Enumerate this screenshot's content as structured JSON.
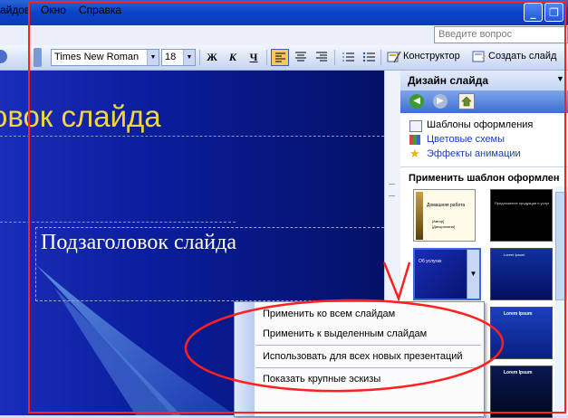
{
  "menubar": {
    "items": [
      "айдов",
      "Окно",
      "Справка"
    ],
    "ask_placeholder": "Введите вопрос"
  },
  "toolbar": {
    "font_name": "Times New Roman",
    "font_size": "18",
    "bold": "Ж",
    "italic": "К",
    "underline": "Ч",
    "designer": "Конструктор",
    "new_slide": "Создать слайд"
  },
  "slide": {
    "title": "овок слайда",
    "subtitle": "Подзаголовок слайда"
  },
  "taskpane": {
    "title": "Дизайн слайда",
    "links": [
      "Шаблоны оформления",
      "Цветовые схемы",
      "Эффекты анимации"
    ],
    "section_title": "Применить шаблон оформлен",
    "thumbs": [
      {
        "title": "Домашняя работа",
        "lines": [
          "[Автор]",
          "[Дисциплина]"
        ]
      },
      {
        "title": "Предложение продукции и услуг",
        "lines": []
      },
      {
        "title": "Об услугах",
        "lines": []
      },
      {
        "title": "Lorem Ipsum",
        "lines": []
      },
      {
        "title": "Lorem Ipsum",
        "lines": []
      },
      {
        "title": "Lorem Ipsum",
        "lines": []
      }
    ]
  },
  "context_menu": {
    "items": [
      "Применить ко всем слайдам",
      "Применить к выделенным слайдам",
      "Использовать для всех новых презентаций",
      "Показать крупные эскизы"
    ]
  },
  "colors": {
    "annotation_red": "#ff2020",
    "slide_title": "#f5d43e",
    "xp_blue": "#0a43c9"
  }
}
